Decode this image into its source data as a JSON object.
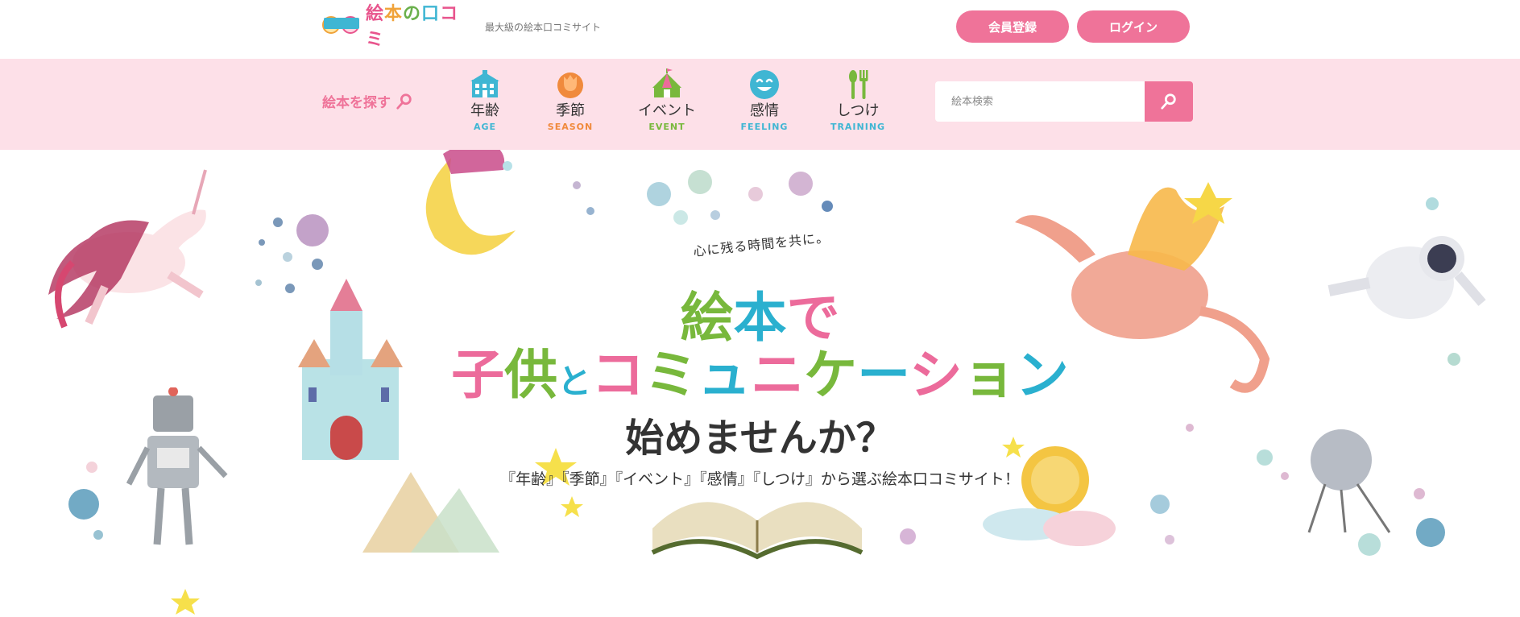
{
  "header": {
    "logo_text": [
      "絵",
      "本",
      "の",
      "口",
      "コミ"
    ],
    "tagline": "最大級の絵本口コミサイト",
    "register_label": "会員登録",
    "login_label": "ログイン"
  },
  "nav": {
    "find_label": "絵本を探す",
    "categories": [
      {
        "ja": "年齢",
        "en": "AGE",
        "color": "#3fb6d3",
        "icon": "school-icon"
      },
      {
        "ja": "季節",
        "en": "SEASON",
        "color": "#f08a3c",
        "icon": "tulip-icon"
      },
      {
        "ja": "イベント",
        "en": "EVENT",
        "color": "#78b83c",
        "icon": "circus-tent-icon"
      },
      {
        "ja": "感情",
        "en": "FEELING",
        "color": "#3fb6d3",
        "icon": "smiley-icon"
      },
      {
        "ja": "しつけ",
        "en": "TRAINING",
        "color": "#3fb6d3",
        "icon": "fork-spoon-icon"
      }
    ],
    "search_placeholder": "絵本検索"
  },
  "hero": {
    "catchphrase": "心に残る時間を共に。",
    "line1": [
      {
        "text": "絵",
        "color": "#78b83c"
      },
      {
        "text": "本",
        "color": "#2ab0cf"
      },
      {
        "text": "で",
        "color": "#ec6b9b"
      }
    ],
    "line2": [
      {
        "text": "子",
        "color": "#ec6b9b"
      },
      {
        "text": "供",
        "color": "#78b83c"
      },
      {
        "text": "と",
        "color": "#2ab0cf"
      },
      {
        "text": "コ",
        "color": "#ec6b9b"
      },
      {
        "text": "ミ",
        "color": "#78b83c"
      },
      {
        "text": "ュ",
        "color": "#2ab0cf"
      },
      {
        "text": "ニ",
        "color": "#ec6b9b"
      },
      {
        "text": "ケ",
        "color": "#78b83c"
      },
      {
        "text": "ー",
        "color": "#2ab0cf"
      },
      {
        "text": "シ",
        "color": "#ec6b9b"
      },
      {
        "text": "ョ",
        "color": "#78b83c"
      },
      {
        "text": "ン",
        "color": "#2ab0cf"
      }
    ],
    "line3": "始めませんか？",
    "lead": "『年齢』『季節』『イベント』『感情』『しつけ』から選ぶ絵本口コミサイト！"
  },
  "colors": {
    "accent": "#ef7399",
    "nav_bg": "#fde0e8"
  }
}
